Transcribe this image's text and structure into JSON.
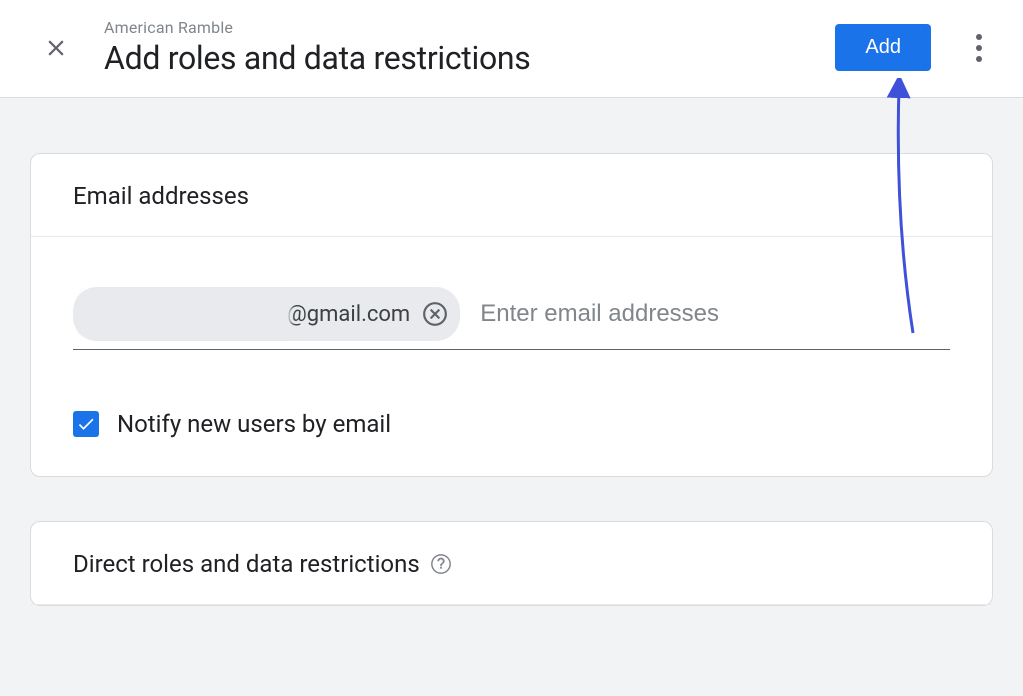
{
  "header": {
    "property_name": "American Ramble",
    "title": "Add roles and data restrictions",
    "add_button": "Add"
  },
  "email_card": {
    "title": "Email addresses",
    "chip_suffix": "@gmail.com",
    "input_placeholder": "Enter email addresses",
    "notify_label": "Notify new users by email",
    "notify_checked": true
  },
  "roles_card": {
    "title": "Direct roles and data restrictions"
  }
}
